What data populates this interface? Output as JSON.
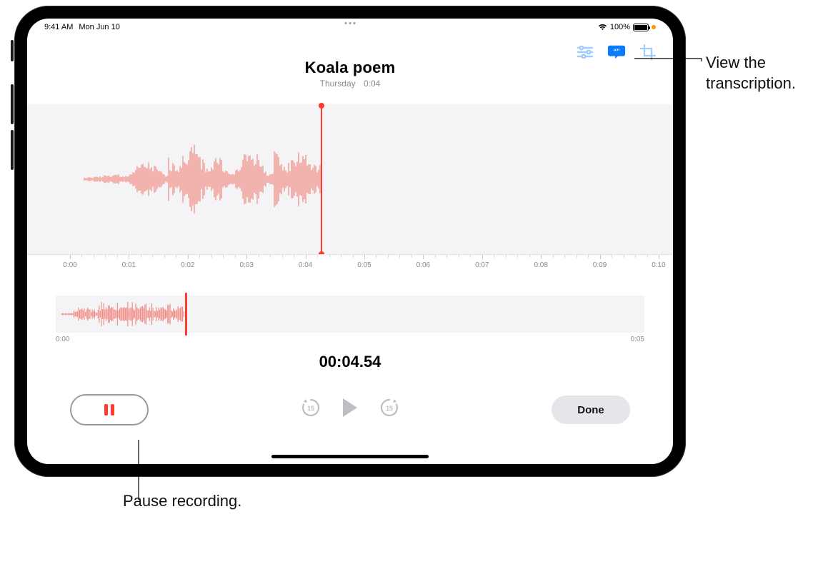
{
  "status": {
    "time": "9:41 AM",
    "date": "Mon Jun 10",
    "battery": "100%"
  },
  "toolbar": {
    "options_icon": "options",
    "transcription_icon": "transcription",
    "crop_icon": "trim"
  },
  "recording": {
    "title": "Koala poem",
    "day": "Thursday",
    "duration": "0:04"
  },
  "ruler": {
    "ticks": [
      "0:00",
      "0:01",
      "0:02",
      "0:03",
      "0:04",
      "0:05",
      "0:06",
      "0:07",
      "0:08",
      "0:09",
      "0:10"
    ]
  },
  "overview": {
    "start": "0:00",
    "end": "0:05"
  },
  "timer": "00:04.54",
  "controls": {
    "skip_back": "15",
    "skip_fwd": "15",
    "done": "Done"
  },
  "callouts": {
    "transcription": "View the transcription.",
    "pause": "Pause recording."
  },
  "colors": {
    "accent": "#ff3b30",
    "active": "#007aff"
  }
}
